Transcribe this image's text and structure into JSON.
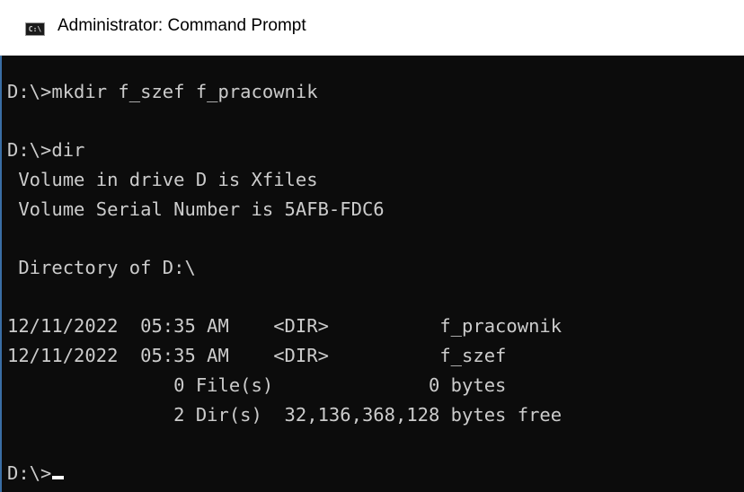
{
  "window": {
    "title": "Administrator: Command Prompt",
    "icon": "C:\\"
  },
  "console": {
    "lines": [
      "D:\\>mkdir f_szef f_pracownik",
      "D:\\>dir",
      " Volume in drive D is Xfiles",
      " Volume Serial Number is 5AFB-FDC6",
      " Directory of D:\\",
      "12/11/2022  05:35 AM    <DIR>          f_pracownik",
      "12/11/2022  05:35 AM    <DIR>          f_szef",
      "               0 File(s)              0 bytes",
      "               2 Dir(s)  32,136,368,128 bytes free",
      "D:\\>"
    ]
  }
}
